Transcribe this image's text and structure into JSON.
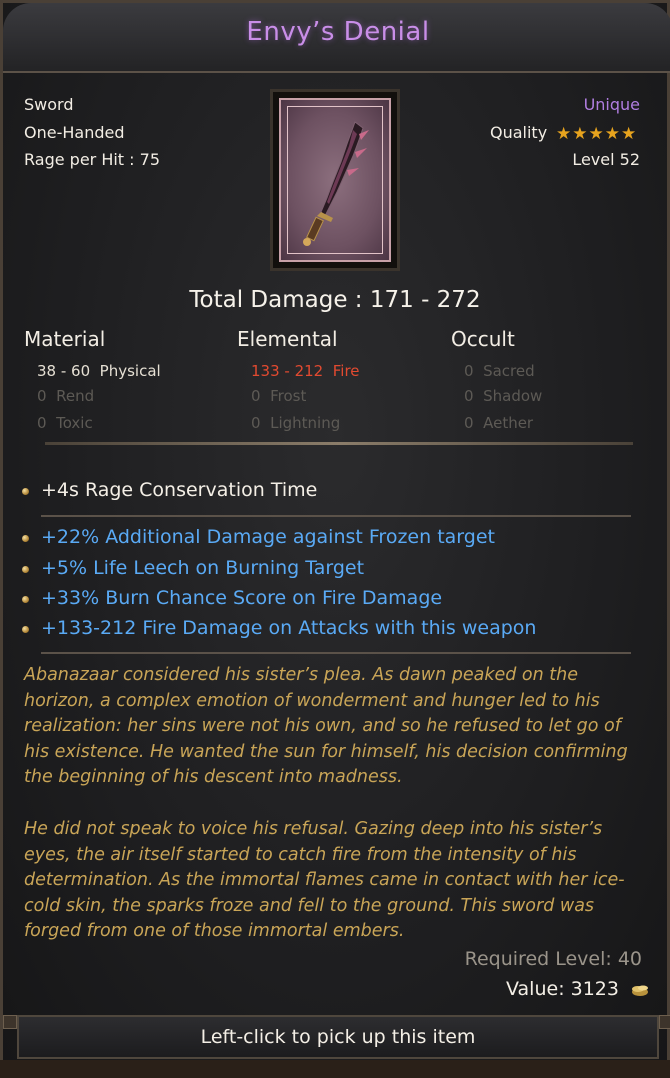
{
  "title": "Envy’s Denial",
  "header": {
    "type": "Sword",
    "handedness": "One-Handed",
    "rage": "Rage per Hit : 75",
    "rarity": "Unique",
    "quality_label": "Quality",
    "quality_stars": 5,
    "level": "Level 52"
  },
  "total_damage": "Total Damage : 171 - 272",
  "columns": {
    "material": {
      "title": "Material",
      "rows": [
        {
          "num": "38 - 60",
          "name": "Physical"
        },
        {
          "num": "0",
          "name": "Rend"
        },
        {
          "num": "0",
          "name": "Toxic"
        }
      ]
    },
    "elemental": {
      "title": "Elemental",
      "rows": [
        {
          "num": "133 - 212",
          "name": "Fire"
        },
        {
          "num": "0",
          "name": "Frost"
        },
        {
          "num": "0",
          "name": "Lightning"
        }
      ]
    },
    "occult": {
      "title": "Occult",
      "rows": [
        {
          "num": "0",
          "name": "Sacred"
        },
        {
          "num": "0",
          "name": "Shadow"
        },
        {
          "num": "0",
          "name": "Aether"
        }
      ]
    }
  },
  "mods": {
    "base": "+4s Rage Conservation Time",
    "unique": [
      "+22% Additional Damage against Frozen target",
      "+5% Life Leech on Burning Target",
      "+33% Burn Chance Score on Fire Damage",
      "+133-212 Fire Damage on Attacks with this weapon"
    ]
  },
  "lore": {
    "p1": "Abanazaar considered his sister’s plea. As dawn peaked on the\nhorizon, a complex emotion of wonderment and hunger led to his\nrealization: her sins were not his own, and so he refused to let go of\nhis existence. He wanted the sun for himself, his decision confirming\nthe beginning of his descent into madness.",
    "p2": "He did not speak to voice his refusal. Gazing deep into his sister’s\neyes, the air itself started to catch fire from the intensity of his\ndetermination. As the immortal flames came in contact with her ice-\ncold skin, the sparks froze and fell to the ground. This sword was\nforged from one of those immortal embers."
  },
  "required_level": "Required Level: 40",
  "value": "Value: 3123",
  "footer": "Left-click to pick up this item",
  "colors": {
    "title": "#c98ee8",
    "rarity": "#b07de0",
    "blue_mod": "#5aaaf5",
    "fire": "#e24a30",
    "lore": "#c9a557",
    "star": "#e6a31e"
  }
}
